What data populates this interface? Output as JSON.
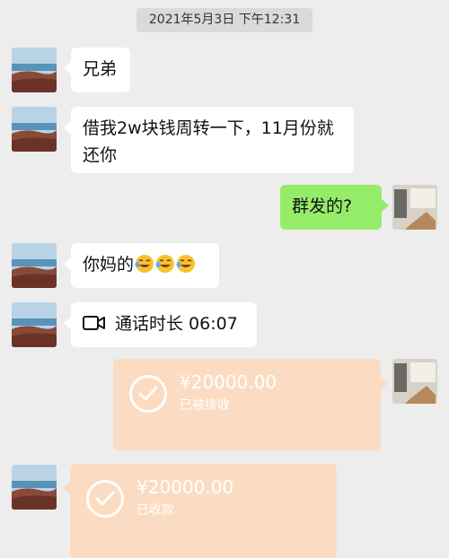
{
  "timestamp": "2021年5月3日 下午12:31",
  "messages": {
    "m1": "兄弟",
    "m2": "借我2w块钱周转一下，11月份就还你",
    "m3": "群发的?",
    "m4": "你妈的",
    "call_label": "通话时长 06:07",
    "transfer1": {
      "amount": "¥20000.00",
      "status": "已被接收"
    },
    "transfer2": {
      "amount": "¥20000.00",
      "status": "已收款"
    }
  },
  "icons": {
    "emoji": "face-with-tears-of-joy-icon",
    "call": "video-call-icon",
    "check": "check-circle-icon"
  },
  "colors": {
    "background": "#ededed",
    "self_bubble": "#95ec69",
    "other_bubble": "#ffffff",
    "transfer_bg": "#fbdcc2"
  }
}
